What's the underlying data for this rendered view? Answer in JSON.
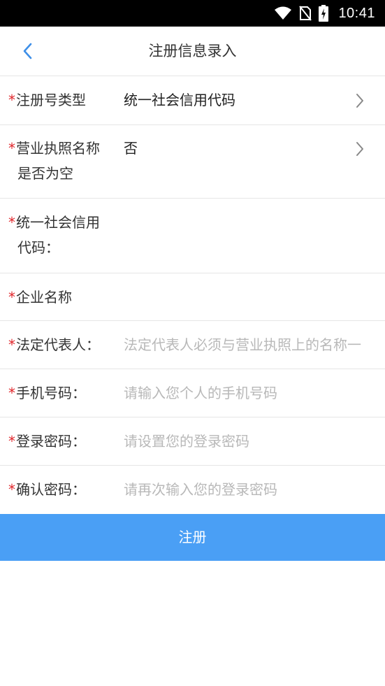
{
  "status_bar": {
    "time": "10:41"
  },
  "header": {
    "title": "注册信息录入"
  },
  "form": {
    "rows": [
      {
        "star": "*",
        "label": "注册号类型",
        "value": "统一社会信用代码"
      },
      {
        "star": "*",
        "label_line1": "营业执照名称",
        "label_line2": "是否为空",
        "value": "否"
      },
      {
        "star": "*",
        "label_line1": "统一社会信用",
        "label_line2": "代码：",
        "value": ""
      },
      {
        "star": "*",
        "label": "企业名称",
        "value": ""
      },
      {
        "star": "*",
        "label": "法定代表人：",
        "placeholder": "法定代表人必须与营业执照上的名称一"
      },
      {
        "star": "*",
        "label": "手机号码：",
        "placeholder": "请输入您个人的手机号码"
      },
      {
        "star": "*",
        "label": "登录密码：",
        "placeholder": "请设置您的登录密码"
      },
      {
        "star": "*",
        "label": "确认密码：",
        "placeholder": "请再次输入您的登录密码"
      }
    ]
  },
  "submit": {
    "label": "注册"
  },
  "colors": {
    "accent": "#4a9ff5",
    "required": "#e0262b",
    "placeholder": "#b8b8b8"
  }
}
